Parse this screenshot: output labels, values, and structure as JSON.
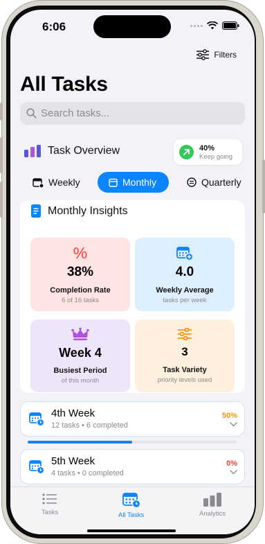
{
  "status": {
    "time": "6:06"
  },
  "header": {
    "filters_label": "Filters",
    "title": "All Tasks"
  },
  "search": {
    "placeholder": "Search tasks..."
  },
  "overview": {
    "title": "Task Overview",
    "progress_pct": "40%",
    "progress_sub": "Keep going"
  },
  "tabs": [
    {
      "label": "Weekly",
      "active": false
    },
    {
      "label": "Monthly",
      "active": true
    },
    {
      "label": "Quarterly",
      "active": false
    }
  ],
  "insights": {
    "title": "Monthly Insights",
    "metrics": [
      {
        "icon": "percent-icon",
        "value": "38%",
        "label": "Completion Rate",
        "sub": "6 of 16 tasks",
        "bg": "#fde4e3",
        "accent": "#ff3b30"
      },
      {
        "icon": "calendar-plus-icon",
        "value": "4.0",
        "label": "Weekly Average",
        "sub": "tasks per week",
        "bg": "#ddeefd",
        "accent": "#0a84ff"
      },
      {
        "icon": "crown-icon",
        "value": "Week 4",
        "label": "Busiest Period",
        "sub": "of this month",
        "bg": "#efe5fb",
        "accent": "#af52de"
      },
      {
        "icon": "sliders-icon",
        "value": "3",
        "label": "Task Variety",
        "sub": "priority levels used",
        "bg": "#fdf0de",
        "accent": "#ff9500"
      }
    ]
  },
  "weeks": [
    {
      "title": "4th Week",
      "summary": "12 tasks • 6 completed",
      "pct": "50%",
      "pct_color": "#ff9500",
      "progress": 0.5
    },
    {
      "title": "5th Week",
      "summary": "4 tasks • 0 completed",
      "pct": "0%",
      "pct_color": "#ff3b30",
      "progress": 0
    }
  ],
  "tabbar": [
    {
      "label": "Tasks",
      "icon": "list-icon",
      "active": false
    },
    {
      "label": "All Tasks",
      "icon": "calendar-clock-icon",
      "active": true
    },
    {
      "label": "Analytics",
      "icon": "bar-chart-icon",
      "active": false
    }
  ],
  "colors": {
    "accent": "#0a84ff",
    "success": "#34c759"
  }
}
